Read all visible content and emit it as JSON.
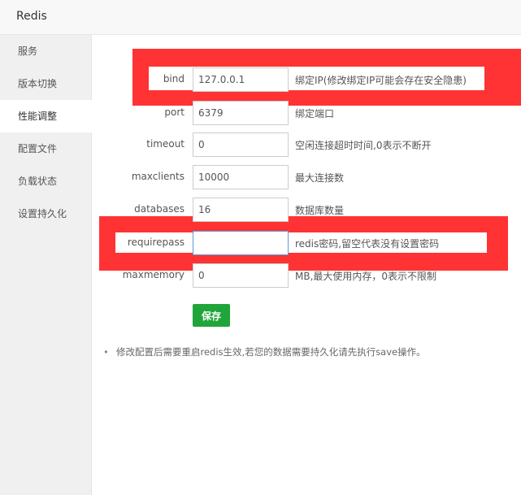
{
  "window": {
    "title": "Redis"
  },
  "sidebar": {
    "items": [
      {
        "label": "服务"
      },
      {
        "label": "版本切换"
      },
      {
        "label": "性能调整",
        "active": true
      },
      {
        "label": "配置文件"
      },
      {
        "label": "负载状态"
      },
      {
        "label": "设置持久化"
      }
    ]
  },
  "form": {
    "fields": [
      {
        "key": "bind",
        "label": "bind",
        "value": "127.0.0.1",
        "hint": "绑定IP(修改绑定IP可能会存在安全隐患)"
      },
      {
        "key": "port",
        "label": "port",
        "value": "6379",
        "hint": "绑定端口"
      },
      {
        "key": "timeout",
        "label": "timeout",
        "value": "0",
        "hint": "空闲连接超时时间,0表示不断开"
      },
      {
        "key": "maxclients",
        "label": "maxclients",
        "value": "10000",
        "hint": "最大连接数"
      },
      {
        "key": "databases",
        "label": "databases",
        "value": "16",
        "hint": "数据库数量"
      },
      {
        "key": "requirepass",
        "label": "requirepass",
        "value": "",
        "hint": "redis密码,留空代表没有设置密码"
      },
      {
        "key": "maxmemory",
        "label": "maxmemory",
        "value": "0",
        "hint": "MB,最大使用内存，0表示不限制"
      }
    ],
    "save_label": "保存",
    "note": "修改配置后需要重启redis生效,若您的数据需要持久化请先执行save操作。"
  },
  "colors": {
    "accent": "#20a53a",
    "highlight_box": "#ff3333"
  }
}
